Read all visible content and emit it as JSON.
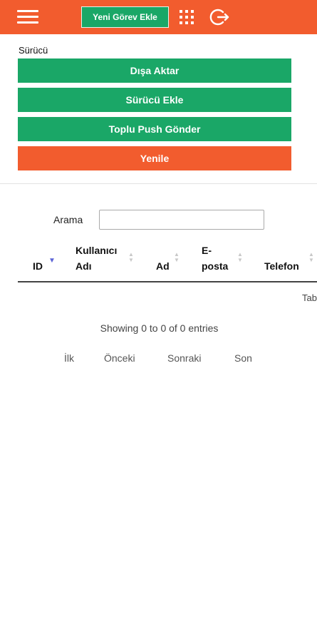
{
  "header": {
    "new_task_label": "Yeni Görev Ekle",
    "menu_icon": "hamburger-icon",
    "apps_icon": "grid-icon",
    "logout_icon": "logout-icon",
    "accent": "#f25c2e"
  },
  "section": {
    "title": "Sürücü"
  },
  "actions": {
    "export_label": "Dışa Aktar",
    "add_driver_label": "Sürücü Ekle",
    "bulk_push_label": "Toplu Push Gönder",
    "refresh_label": "Yenile",
    "green": "#1aa767",
    "orange": "#f25c2e"
  },
  "table": {
    "search_label": "Arama",
    "search_value": "",
    "columns": [
      {
        "line1": "ID",
        "line2": ""
      },
      {
        "line1": "Kullanıcı",
        "line2": "Adı"
      },
      {
        "line1": "Ad",
        "line2": ""
      },
      {
        "line1": "E-",
        "line2": "posta"
      },
      {
        "line1": "Telefon",
        "line2": ""
      }
    ],
    "empty_text": "Tablo",
    "info": "Showing 0 to 0 of 0 entries"
  },
  "pagination": {
    "first": "İlk",
    "previous": "Önceki",
    "next": "Sonraki",
    "last": "Son"
  }
}
